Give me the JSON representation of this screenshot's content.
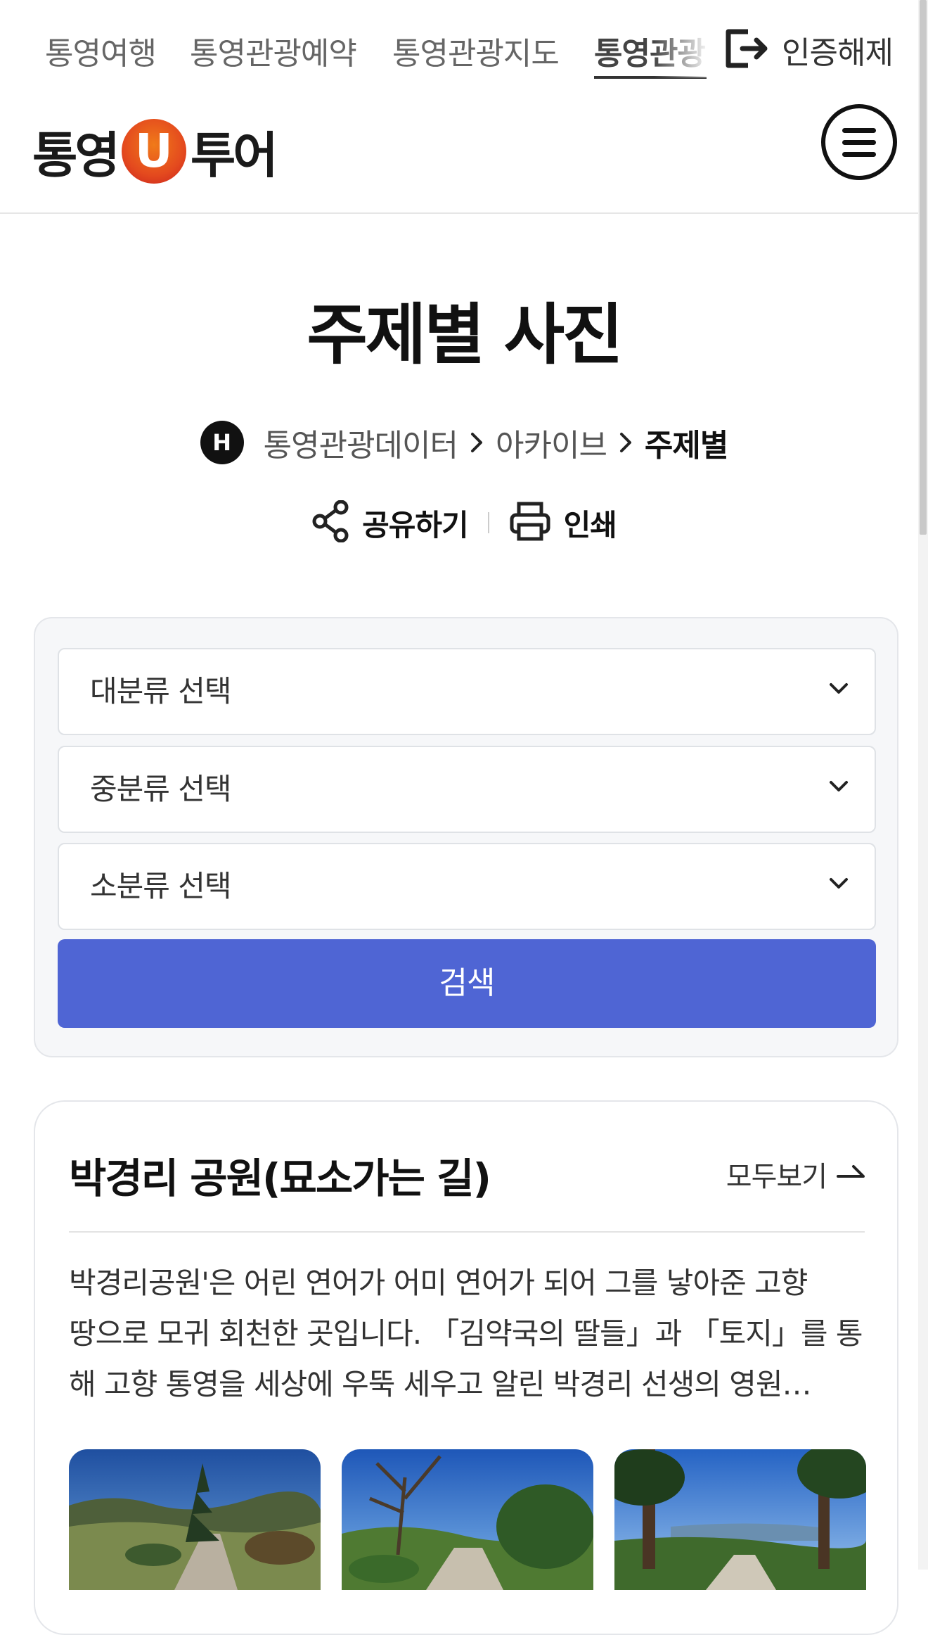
{
  "topnav": {
    "items": [
      "통영여행",
      "통영관광예약",
      "통영관광지도",
      "통영관광"
    ],
    "logout_label": "인증해제"
  },
  "header": {
    "logo_left": "통영",
    "logo_mid": "U",
    "logo_right": "투어"
  },
  "page": {
    "title": "주제별 사진"
  },
  "breadcrumb": {
    "home_icon_letter": "H",
    "items": [
      "통영관광데이터",
      "아카이브",
      "주제별"
    ]
  },
  "actions": {
    "share_label": "공유하기",
    "print_label": "인쇄"
  },
  "search": {
    "major_placeholder": "대분류 선택",
    "middle_placeholder": "중분류 선택",
    "minor_placeholder": "소분류 선택",
    "button_label": "검색"
  },
  "card": {
    "title": "박경리 공원(묘소가는 길)",
    "more_label": "모두보기",
    "description_lines": [
      "박경리공원'은 어린 연어가 어미 연어가 되어 그를 낳아준 고향",
      "땅으로 모귀 회천한 곳입니다. 「김약국의 딸들」과 「토지」를 통",
      "해 고향 통영을 세상에 우뚝 세우고 알린 박경리 선생의 영원…"
    ]
  },
  "colors": {
    "accent": "#4f65d4",
    "logo_orange": "#e44a1e",
    "text_dark": "#111111"
  }
}
